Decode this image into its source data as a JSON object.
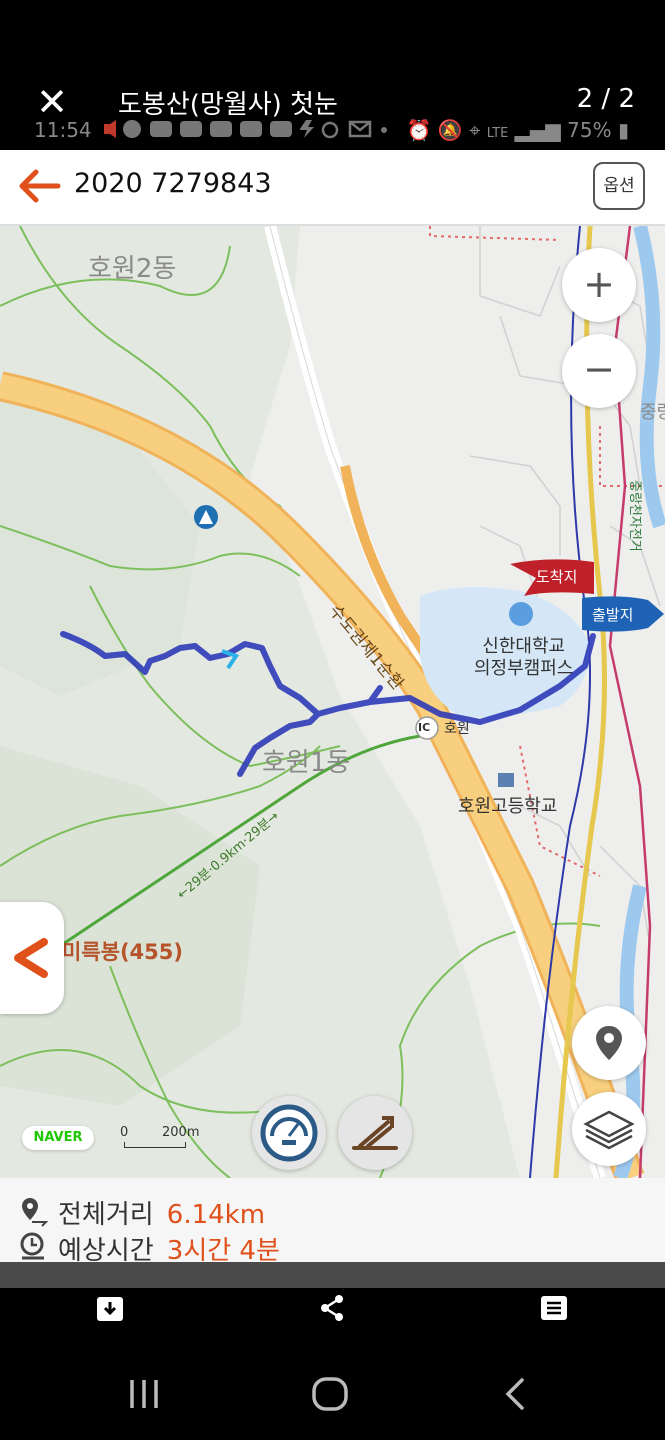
{
  "viewer": {
    "title": "도봉산(망월사) 첫눈",
    "page_counter": "2 / 2",
    "close_symbol": "✕"
  },
  "status_bar": {
    "time": "11:54",
    "battery": "75%",
    "network": "LTE"
  },
  "header": {
    "route_title": "2020 7279843",
    "options_label": "옵션",
    "accent_color": "#e0501a"
  },
  "map": {
    "labels": {
      "dong_2": "호원2동",
      "dong_1": "호원1동",
      "university": "신한대학교\n의정부캠퍼스",
      "highschool": "호원고등학교",
      "peak": "미륵봉(455)",
      "highway": "수도권제1순환",
      "ic_badge": "IC",
      "ic_name": "호원",
      "trail_time": "←29분·0.9km·29분→",
      "right_edge_1": "중랑",
      "right_edge_2": "중랑천자전거"
    },
    "markers": {
      "arrival": "도착지",
      "departure": "출발지"
    },
    "controls": {
      "zoom_in": "+",
      "zoom_out": "−"
    },
    "naver_logo": "NAVER",
    "scale_zero": "0",
    "scale_label": "200m",
    "route_color": "#2d3bb8",
    "arrival_color": "#c0202a",
    "departure_color": "#1e63b5"
  },
  "summary": {
    "distance_label": "전체거리",
    "distance_value": "6.14km",
    "time_label": "예상시간",
    "time_value": "3시간 4분"
  }
}
